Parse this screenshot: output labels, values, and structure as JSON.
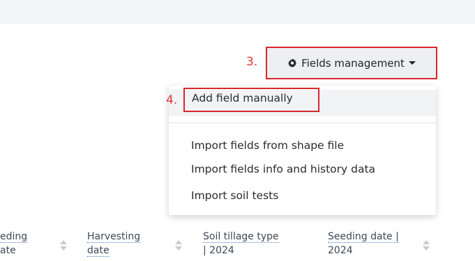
{
  "annotations": {
    "step3": "3.",
    "step4": "4."
  },
  "fields_management": {
    "label": "Fields management",
    "icon": "gear-icon"
  },
  "dropdown": {
    "items": [
      {
        "label": "Add field manually"
      },
      {
        "label": "Import fields from shape file"
      },
      {
        "label": "Import fields info and history data"
      },
      {
        "label": "Import soil tests"
      }
    ]
  },
  "table_header": {
    "columns": [
      {
        "line1": "eding",
        "line2": "ate"
      },
      {
        "line1": "Harvesting",
        "line2": "date"
      },
      {
        "line1": "Soil tillage type",
        "line2": "| 2024"
      },
      {
        "line1": "Seeding date |",
        "line2": "2024"
      }
    ]
  },
  "colors": {
    "annotation_red": "#d9262d",
    "link_underline": "#4a7fc1"
  }
}
